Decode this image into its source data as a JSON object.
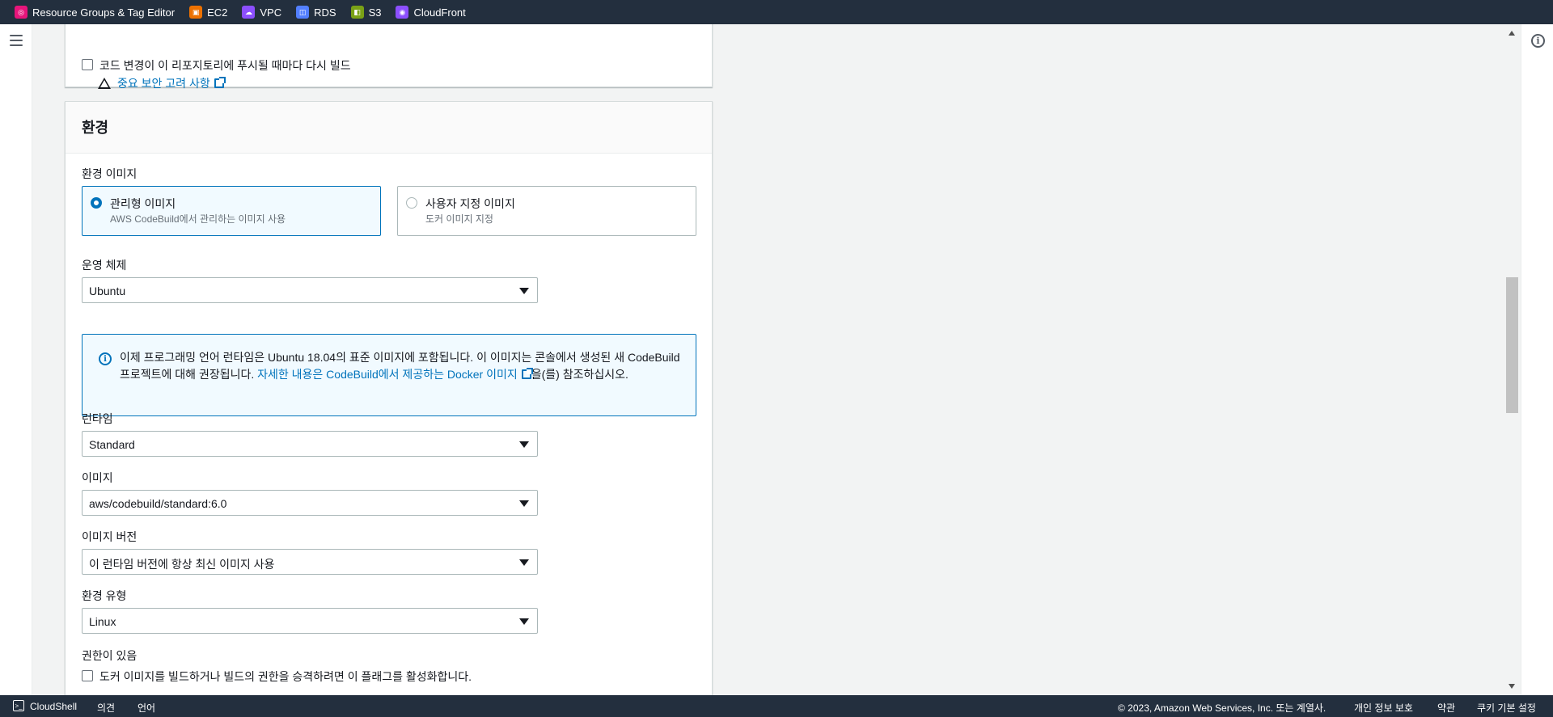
{
  "favorites": [
    {
      "label": "Resource Groups & Tag Editor",
      "icon": "resource-groups-icon",
      "color": "#e7157b"
    },
    {
      "label": "EC2",
      "icon": "ec2-icon",
      "color": "#ed7100"
    },
    {
      "label": "VPC",
      "icon": "vpc-icon",
      "color": "#8c4fff"
    },
    {
      "label": "RDS",
      "icon": "rds-icon",
      "color": "#527fff"
    },
    {
      "label": "S3",
      "icon": "s3-icon",
      "color": "#7aa116"
    },
    {
      "label": "CloudFront",
      "icon": "cloudfront-icon",
      "color": "#8c4fff"
    }
  ],
  "source_panel": {
    "webhook_checkbox_label": "코드 변경이 이 리포지토리에 푸시될 때마다 다시 빌드",
    "security_link": "중요 보안 고려 사항"
  },
  "environment": {
    "title": "환경",
    "image_label": "환경 이미지",
    "managed_title": "관리형 이미지",
    "managed_desc": "AWS CodeBuild에서 관리하는 이미지 사용",
    "custom_title": "사용자 지정 이미지",
    "custom_desc": "도커 이미지 지정",
    "os_label": "운영 체제",
    "os_value": "Ubuntu",
    "info_text_1": "이제 프로그래밍 언어 런타임은 Ubuntu 18.04의 표준 이미지에 포함됩니다. 이 이미지는 콘솔에서 생성된 새 CodeBuild 프로젝트에 대해 권장됩니다. ",
    "info_link": "자세한 내용은 CodeBuild에서 제공하는 Docker 이미지",
    "info_text_2": "을(를) 참조하십시오.",
    "runtime_label": "런타임",
    "runtime_value": "Standard",
    "image_select_label": "이미지",
    "image_value": "aws/codebuild/standard:6.0",
    "image_version_label": "이미지 버전",
    "image_version_value": "이 런타임 버전에 항상 최신 이미지 사용",
    "env_type_label": "환경 유형",
    "env_type_value": "Linux",
    "privileged_label": "권한이 있음",
    "privileged_checkbox_label": "도커 이미지를 빌드하거나 빌드의 권한을 승격하려면 이 플래그를 활성화합니다."
  },
  "footer": {
    "cloudshell": "CloudShell",
    "feedback": "의견",
    "language": "언어",
    "copyright": "© 2023, Amazon Web Services, Inc. 또는 계열사.",
    "privacy": "개인 정보 보호",
    "terms": "약관",
    "cookies": "쿠키 기본 설정"
  },
  "colors": {
    "nav_bg": "#232f3e",
    "link": "#0073bb",
    "selected_bg": "#f1faff"
  }
}
